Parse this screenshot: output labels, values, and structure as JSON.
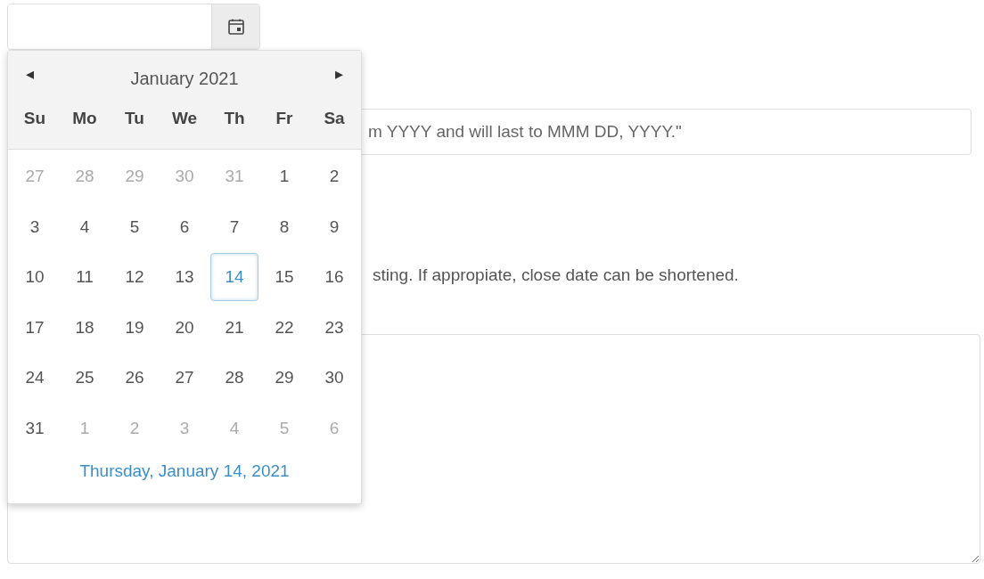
{
  "calendar": {
    "title": "January 2021",
    "prev": "◂",
    "next": "▸",
    "weekdays": [
      "Su",
      "Mo",
      "Tu",
      "We",
      "Th",
      "Fr",
      "Sa"
    ],
    "weeks": [
      [
        {
          "label": "27",
          "other_month": true,
          "selected": false
        },
        {
          "label": "28",
          "other_month": true,
          "selected": false
        },
        {
          "label": "29",
          "other_month": true,
          "selected": false
        },
        {
          "label": "30",
          "other_month": true,
          "selected": false
        },
        {
          "label": "31",
          "other_month": true,
          "selected": false
        },
        {
          "label": "1",
          "other_month": false,
          "selected": false
        },
        {
          "label": "2",
          "other_month": false,
          "selected": false
        }
      ],
      [
        {
          "label": "3",
          "other_month": false,
          "selected": false
        },
        {
          "label": "4",
          "other_month": false,
          "selected": false
        },
        {
          "label": "5",
          "other_month": false,
          "selected": false
        },
        {
          "label": "6",
          "other_month": false,
          "selected": false
        },
        {
          "label": "7",
          "other_month": false,
          "selected": false
        },
        {
          "label": "8",
          "other_month": false,
          "selected": false
        },
        {
          "label": "9",
          "other_month": false,
          "selected": false
        }
      ],
      [
        {
          "label": "10",
          "other_month": false,
          "selected": false
        },
        {
          "label": "11",
          "other_month": false,
          "selected": false
        },
        {
          "label": "12",
          "other_month": false,
          "selected": false
        },
        {
          "label": "13",
          "other_month": false,
          "selected": false
        },
        {
          "label": "14",
          "other_month": false,
          "selected": true
        },
        {
          "label": "15",
          "other_month": false,
          "selected": false
        },
        {
          "label": "16",
          "other_month": false,
          "selected": false
        }
      ],
      [
        {
          "label": "17",
          "other_month": false,
          "selected": false
        },
        {
          "label": "18",
          "other_month": false,
          "selected": false
        },
        {
          "label": "19",
          "other_month": false,
          "selected": false
        },
        {
          "label": "20",
          "other_month": false,
          "selected": false
        },
        {
          "label": "21",
          "other_month": false,
          "selected": false
        },
        {
          "label": "22",
          "other_month": false,
          "selected": false
        },
        {
          "label": "23",
          "other_month": false,
          "selected": false
        }
      ],
      [
        {
          "label": "24",
          "other_month": false,
          "selected": false
        },
        {
          "label": "25",
          "other_month": false,
          "selected": false
        },
        {
          "label": "26",
          "other_month": false,
          "selected": false
        },
        {
          "label": "27",
          "other_month": false,
          "selected": false
        },
        {
          "label": "28",
          "other_month": false,
          "selected": false
        },
        {
          "label": "29",
          "other_month": false,
          "selected": false
        },
        {
          "label": "30",
          "other_month": false,
          "selected": false
        }
      ],
      [
        {
          "label": "31",
          "other_month": false,
          "selected": false
        },
        {
          "label": "1",
          "other_month": true,
          "selected": false
        },
        {
          "label": "2",
          "other_month": true,
          "selected": false
        },
        {
          "label": "3",
          "other_month": true,
          "selected": false
        },
        {
          "label": "4",
          "other_month": true,
          "selected": false
        },
        {
          "label": "5",
          "other_month": true,
          "selected": false
        },
        {
          "label": "6",
          "other_month": true,
          "selected": false
        }
      ]
    ],
    "footer": "Thursday, January 14, 2021"
  },
  "description_field": {
    "placeholder": "m YYYY and will last to MMM DD, YYYY.\""
  },
  "hint": "sting. If appropiate, close date can be shortened."
}
